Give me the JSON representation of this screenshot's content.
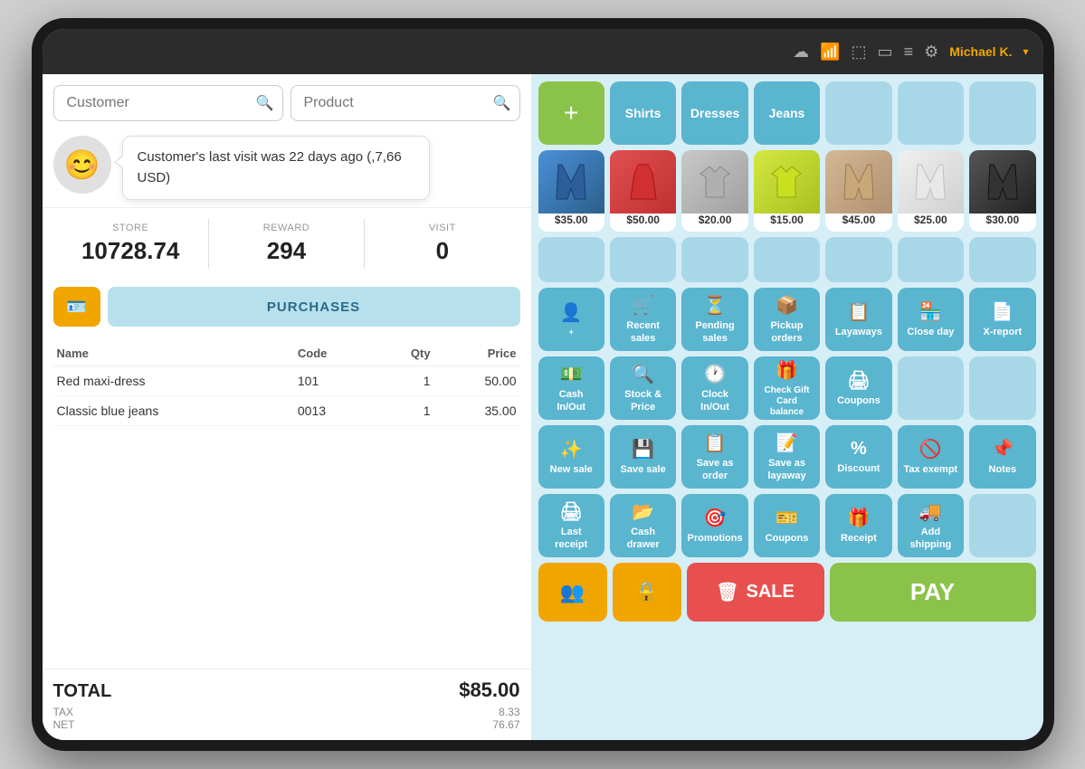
{
  "topbar": {
    "user": "Michael K.",
    "arrow": "▾",
    "icons": [
      "☁",
      "📶",
      "⬚",
      "▭",
      "≡",
      "⚙"
    ]
  },
  "search": {
    "customer_placeholder": "Customer",
    "product_placeholder": "Product"
  },
  "tooltip": {
    "message": "Customer's last visit was 22 days ago (,7,66 USD)"
  },
  "stats": {
    "store_label": "STORE",
    "store_value": "10728.74",
    "reward_label": "REWARD",
    "reward_value": "294",
    "visit_label": "VISIT",
    "visit_value": "0"
  },
  "buttons": {
    "purchases": "PURCHASES"
  },
  "table": {
    "headers": [
      "Name",
      "Code",
      "Qty",
      "Price"
    ],
    "rows": [
      {
        "name": "Red maxi-dress",
        "code": "101",
        "qty": "1",
        "price": "50.00"
      },
      {
        "name": "Classic blue jeans",
        "code": "0013",
        "qty": "1",
        "price": "35.00"
      }
    ]
  },
  "totals": {
    "label": "TOTAL",
    "amount": "$85.00",
    "tax_label": "TAX",
    "tax_value": "8.33",
    "net_label": "NET",
    "net_value": "76.67"
  },
  "categories": {
    "add_label": "+",
    "items": [
      "Shirts",
      "Dresses",
      "Jeans",
      "",
      "",
      "",
      ""
    ]
  },
  "products": [
    {
      "price": "$35.00",
      "type": "jeans"
    },
    {
      "price": "$50.00",
      "type": "dress"
    },
    {
      "price": "$20.00",
      "type": "shirt"
    },
    {
      "price": "$15.00",
      "type": "polo"
    },
    {
      "price": "$45.00",
      "type": "beige"
    },
    {
      "price": "$25.00",
      "type": "white"
    },
    {
      "price": "$30.00",
      "type": "black"
    }
  ],
  "actions_row1": [
    {
      "icon": "👤+",
      "label": "New\ncustomer",
      "type": "add-customer"
    },
    {
      "icon": "🛒",
      "label": "Recent\nsales",
      "type": "recent-sales"
    },
    {
      "icon": "⏳",
      "label": "Pending\nsales",
      "type": "pending-sales"
    },
    {
      "icon": "📦",
      "label": "Pickup\norders",
      "type": "pickup-orders"
    },
    {
      "icon": "📋",
      "label": "Layaways",
      "type": "layaways"
    },
    {
      "icon": "🏪",
      "label": "Close day",
      "type": "close-day"
    },
    {
      "icon": "📄",
      "label": "X-report",
      "type": "x-report"
    }
  ],
  "actions_row2": [
    {
      "icon": "💵",
      "label": "Cash\nIn/Out",
      "type": "cash-inout"
    },
    {
      "icon": "🛒",
      "label": "Stock &\nPrice",
      "type": "stock-price"
    },
    {
      "icon": "🕐",
      "label": "Clock\nIn/Out",
      "type": "clock-inout"
    },
    {
      "icon": "🎁",
      "label": "Check Gift\nCard\nbalance",
      "type": "gift-card"
    },
    {
      "icon": "🖨",
      "label": "Coupons",
      "type": "coupons"
    },
    {
      "empty": true
    },
    {
      "empty": true
    }
  ],
  "actions_row3": [
    {
      "icon": "✨",
      "label": "New sale",
      "type": "new-sale"
    },
    {
      "icon": "💾",
      "label": "Save sale",
      "type": "save-sale"
    },
    {
      "icon": "📋",
      "label": "Save as\norder",
      "type": "save-order"
    },
    {
      "icon": "📝",
      "label": "Save as\nlayaway",
      "type": "save-layaway"
    },
    {
      "icon": "%",
      "label": "Discount",
      "type": "discount"
    },
    {
      "icon": "🚫%",
      "label": "Tax exempt",
      "type": "tax-exempt"
    },
    {
      "icon": "📌",
      "label": "Notes",
      "type": "notes"
    }
  ],
  "actions_row4": [
    {
      "icon": "🖨",
      "label": "Last receipt",
      "type": "last-receipt"
    },
    {
      "icon": "📂",
      "label": "Cash\ndrawer",
      "type": "cash-drawer"
    },
    {
      "icon": "🎯",
      "label": "Promotions",
      "type": "promotions"
    },
    {
      "icon": "🎫",
      "label": "Coupons",
      "type": "coupons2"
    },
    {
      "icon": "🎁",
      "label": "Receipt",
      "type": "receipt"
    },
    {
      "icon": "🚚",
      "label": "Add\nshipping",
      "type": "add-shipping"
    },
    {
      "empty": true
    }
  ],
  "pay_row": {
    "customers_icon": "👥",
    "lock_icon": "🔒",
    "sale_label": "SALE",
    "pay_label": "PAY"
  }
}
